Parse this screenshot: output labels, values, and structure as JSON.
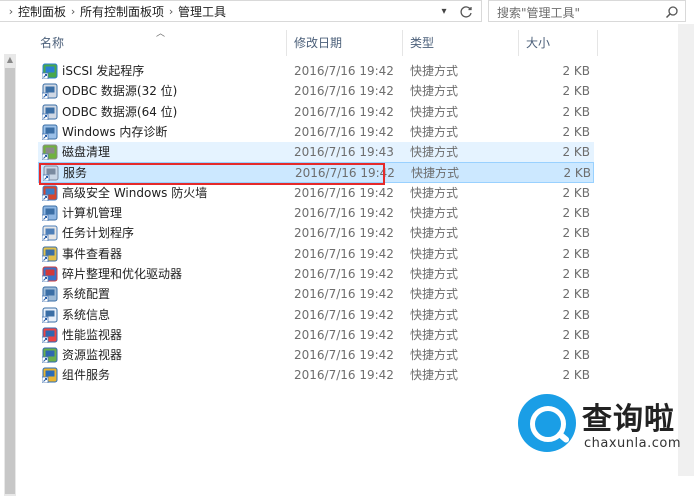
{
  "address": {
    "crumbs": [
      "控制面板",
      "所有控制面板项",
      "管理工具"
    ]
  },
  "search": {
    "placeholder": "搜索\"管理工具\""
  },
  "columns": {
    "name": "名称",
    "date": "修改日期",
    "type": "类型",
    "size": "大小"
  },
  "files": [
    {
      "name": "iSCSI 发起程序",
      "date": "2016/7/16 19:42",
      "type": "快捷方式",
      "size": "2 KB",
      "icon": "iscsi-icon"
    },
    {
      "name": "ODBC 数据源(32 位)",
      "date": "2016/7/16 19:42",
      "type": "快捷方式",
      "size": "2 KB",
      "icon": "odbc-icon"
    },
    {
      "name": "ODBC 数据源(64 位)",
      "date": "2016/7/16 19:42",
      "type": "快捷方式",
      "size": "2 KB",
      "icon": "odbc-icon"
    },
    {
      "name": "Windows 内存诊断",
      "date": "2016/7/16 19:42",
      "type": "快捷方式",
      "size": "2 KB",
      "icon": "memory-diagnostic-icon"
    },
    {
      "name": "磁盘清理",
      "date": "2016/7/16 19:43",
      "type": "快捷方式",
      "size": "2 KB",
      "icon": "disk-cleanup-icon"
    },
    {
      "name": "服务",
      "date": "2016/7/16 19:42",
      "type": "快捷方式",
      "size": "2 KB",
      "icon": "services-icon"
    },
    {
      "name": "高级安全 Windows 防火墙",
      "date": "2016/7/16 19:42",
      "type": "快捷方式",
      "size": "2 KB",
      "icon": "firewall-icon"
    },
    {
      "name": "计算机管理",
      "date": "2016/7/16 19:42",
      "type": "快捷方式",
      "size": "2 KB",
      "icon": "computer-management-icon"
    },
    {
      "name": "任务计划程序",
      "date": "2016/7/16 19:42",
      "type": "快捷方式",
      "size": "2 KB",
      "icon": "task-scheduler-icon"
    },
    {
      "name": "事件查看器",
      "date": "2016/7/16 19:42",
      "type": "快捷方式",
      "size": "2 KB",
      "icon": "event-viewer-icon"
    },
    {
      "name": "碎片整理和优化驱动器",
      "date": "2016/7/16 19:42",
      "type": "快捷方式",
      "size": "2 KB",
      "icon": "defrag-icon"
    },
    {
      "name": "系统配置",
      "date": "2016/7/16 19:42",
      "type": "快捷方式",
      "size": "2 KB",
      "icon": "system-config-icon"
    },
    {
      "name": "系统信息",
      "date": "2016/7/16 19:42",
      "type": "快捷方式",
      "size": "2 KB",
      "icon": "system-info-icon"
    },
    {
      "name": "性能监视器",
      "date": "2016/7/16 19:42",
      "type": "快捷方式",
      "size": "2 KB",
      "icon": "performance-monitor-icon"
    },
    {
      "name": "资源监视器",
      "date": "2016/7/16 19:42",
      "type": "快捷方式",
      "size": "2 KB",
      "icon": "resource-monitor-icon"
    },
    {
      "name": "组件服务",
      "date": "2016/7/16 19:42",
      "type": "快捷方式",
      "size": "2 KB",
      "icon": "component-services-icon"
    }
  ],
  "watermark": {
    "text": "查询啦",
    "sub": "chaxunla.com"
  },
  "colors": {
    "selected_bg": "#cce8ff",
    "hover_bg": "#e5f3ff",
    "highlight_border": "#e52a2a",
    "watermark_blue": "#1a9ee6"
  }
}
